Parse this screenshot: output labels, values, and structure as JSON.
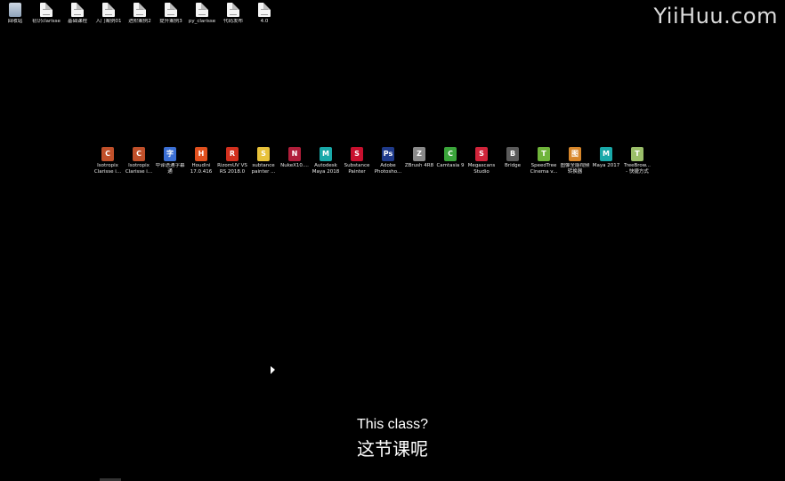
{
  "watermark": "YiiHuu.com",
  "desktop_top": [
    {
      "name": "recycle-bin",
      "label": "回收站",
      "icon": "recycle-bin-icon"
    },
    {
      "name": "clarisse-basics",
      "label": "初识clarisse",
      "icon": "document-icon"
    },
    {
      "name": "basic-course",
      "label": "基础课程",
      "icon": "document-icon"
    },
    {
      "name": "intro-case-01",
      "label": "入门案例01",
      "icon": "document-icon"
    },
    {
      "name": "advanced-case-02",
      "label": "进阶案例2",
      "icon": "document-icon"
    },
    {
      "name": "improve-case-03",
      "label": "提升案例3",
      "icon": "document-icon"
    },
    {
      "name": "py-clarisse",
      "label": "py_clarisse",
      "icon": "document-icon"
    },
    {
      "name": "code-publish",
      "label": "代码发布",
      "icon": "document-icon"
    },
    {
      "name": "version-4-0",
      "label": "4.0",
      "icon": "document-icon"
    }
  ],
  "desktop_apps": [
    {
      "name": "isotropix-clarisse-1",
      "label": "Isotropix\nClarisse i...",
      "glyph": "C",
      "color": "#c0502a"
    },
    {
      "name": "isotropix-clarisse-2",
      "label": "Isotropix\nClarisse i...",
      "glyph": "C",
      "color": "#c0502a"
    },
    {
      "name": "chinese-subtitle",
      "label": "中译语通字幕\n通",
      "glyph": "字",
      "color": "#3b6fd4"
    },
    {
      "name": "houdini",
      "label": "Houdini\n17.0.416",
      "glyph": "H",
      "color": "#e0501e"
    },
    {
      "name": "rizomuv",
      "label": "RizomUV VS\nRS 2018.0",
      "glyph": "R",
      "color": "#d2301e"
    },
    {
      "name": "substance-painter-shortcut",
      "label": "subtance\npainter ...",
      "glyph": "S",
      "color": "#e8c23a"
    },
    {
      "name": "nukex",
      "label": "NukeX10....",
      "glyph": "N",
      "color": "#b01e3a"
    },
    {
      "name": "autodesk-maya-2018",
      "label": "Autodesk\nMaya 2018",
      "glyph": "M",
      "color": "#19a9a9"
    },
    {
      "name": "substance-painter",
      "label": "Substance\nPainter",
      "glyph": "S",
      "color": "#c8102e"
    },
    {
      "name": "adobe-photoshop",
      "label": "Adobe\nPhotosho...",
      "glyph": "Ps",
      "color": "#1f3a8a"
    },
    {
      "name": "zbrush",
      "label": "ZBrush 4R8",
      "glyph": "Z",
      "color": "#8a8a8a"
    },
    {
      "name": "camtasia",
      "label": "Camtasia 9",
      "glyph": "C",
      "color": "#3aa53a"
    },
    {
      "name": "megascans-studio",
      "label": "Megascans\nStudio",
      "glyph": "S",
      "color": "#d0243a"
    },
    {
      "name": "bridge",
      "label": "Bridge",
      "glyph": "B",
      "color": "#5a5a5a"
    },
    {
      "name": "speedtree-cinema",
      "label": "SpeedTree\nCinema v...",
      "glyph": "T",
      "color": "#6fb43a"
    },
    {
      "name": "pinyin-tool",
      "label": "图像全能视频\n转换器",
      "glyph": "图",
      "color": "#d7862a"
    },
    {
      "name": "maya-2017",
      "label": "Maya 2017",
      "glyph": "M",
      "color": "#19a9a9"
    },
    {
      "name": "treebrowser",
      "label": "TreeBrow...\n- 快捷方式",
      "glyph": "T",
      "color": "#9bbf6a"
    }
  ],
  "subtitles": {
    "english": "This class?",
    "chinese": "这节课呢"
  }
}
